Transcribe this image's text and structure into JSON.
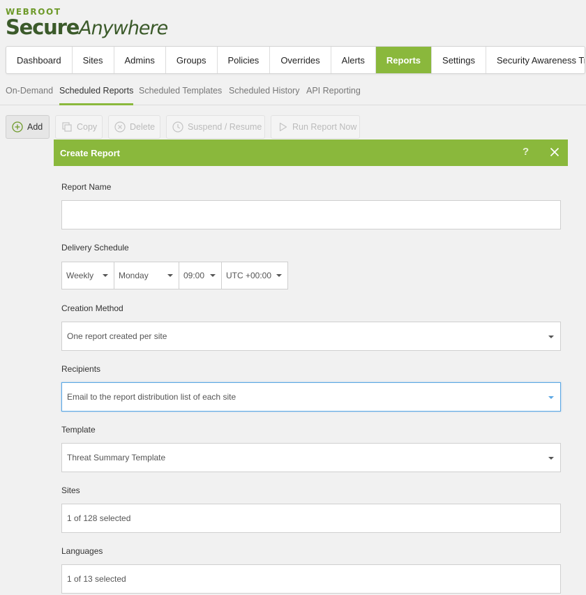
{
  "logo": {
    "top": "WEBROOT",
    "secure": "Secure",
    "anywhere": "Anywhere"
  },
  "nav": {
    "items": [
      {
        "label": "Dashboard"
      },
      {
        "label": "Sites"
      },
      {
        "label": "Admins"
      },
      {
        "label": "Groups"
      },
      {
        "label": "Policies"
      },
      {
        "label": "Overrides"
      },
      {
        "label": "Alerts"
      },
      {
        "label": "Reports",
        "active": true
      },
      {
        "label": "Settings"
      },
      {
        "label": "Security Awareness Training"
      }
    ]
  },
  "subnav": {
    "items": [
      {
        "label": "On-Demand"
      },
      {
        "label": "Scheduled Reports",
        "active": true
      },
      {
        "label": "Scheduled Templates"
      },
      {
        "label": "Scheduled History"
      },
      {
        "label": "API Reporting"
      }
    ]
  },
  "toolbar": {
    "add": "Add",
    "copy": "Copy",
    "delete": "Delete",
    "suspend": "Suspend / Resume",
    "run": "Run Report Now"
  },
  "dialog": {
    "title": "Create Report",
    "help": "?",
    "report_name": {
      "label": "Report Name",
      "value": ""
    },
    "delivery": {
      "label": "Delivery Schedule",
      "frequency": "Weekly",
      "day": "Monday",
      "time": "09:00",
      "timezone": "UTC +00:00"
    },
    "creation_method": {
      "label": "Creation Method",
      "value": "One report created per site"
    },
    "recipients": {
      "label": "Recipients",
      "value": "Email to the report distribution list of each site"
    },
    "template": {
      "label": "Template",
      "value": "Threat Summary Template"
    },
    "sites": {
      "label": "Sites",
      "value": "1 of 128 selected"
    },
    "languages": {
      "label": "Languages",
      "value": "1 of 13 selected"
    }
  },
  "colors": {
    "accent": "#8ab83c",
    "focus": "#5aa7e4",
    "logo": "#3b5a2a"
  }
}
